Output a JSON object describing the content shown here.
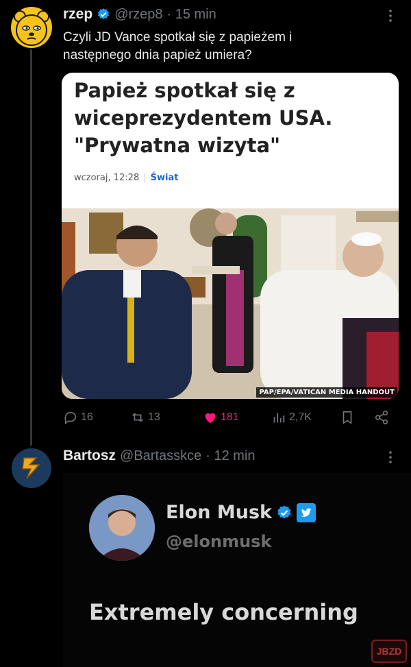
{
  "tweet1": {
    "name": "rzep",
    "handle": "@rzep8",
    "time": "· 15 min",
    "text": "Czyli JD Vance spotkał się z papieżem i następnego dnia papież umiera?",
    "card": {
      "headline": "Papież spotkał się z wiceprezydentem USA. \"Prywatna wizyta\"",
      "date": "wczoraj, 12:28",
      "category": "Świat",
      "photo_credit": "PAP/EPA/VATICAN MEDIA HANDOUT"
    },
    "actions": {
      "replies": "16",
      "reposts": "13",
      "likes": "181",
      "views": "2,7K"
    }
  },
  "tweet2": {
    "name": "Bartosz",
    "handle": "@Bartasskce",
    "time": "· 12 min",
    "embedded": {
      "name": "Elon Musk",
      "handle": "@elonmusk",
      "text": "Extremely concerning"
    }
  },
  "watermark": "JBZD",
  "colors": {
    "background": "#000000",
    "verified": "#1d9bf0",
    "like": "#f91880",
    "muted": "#71767b"
  }
}
